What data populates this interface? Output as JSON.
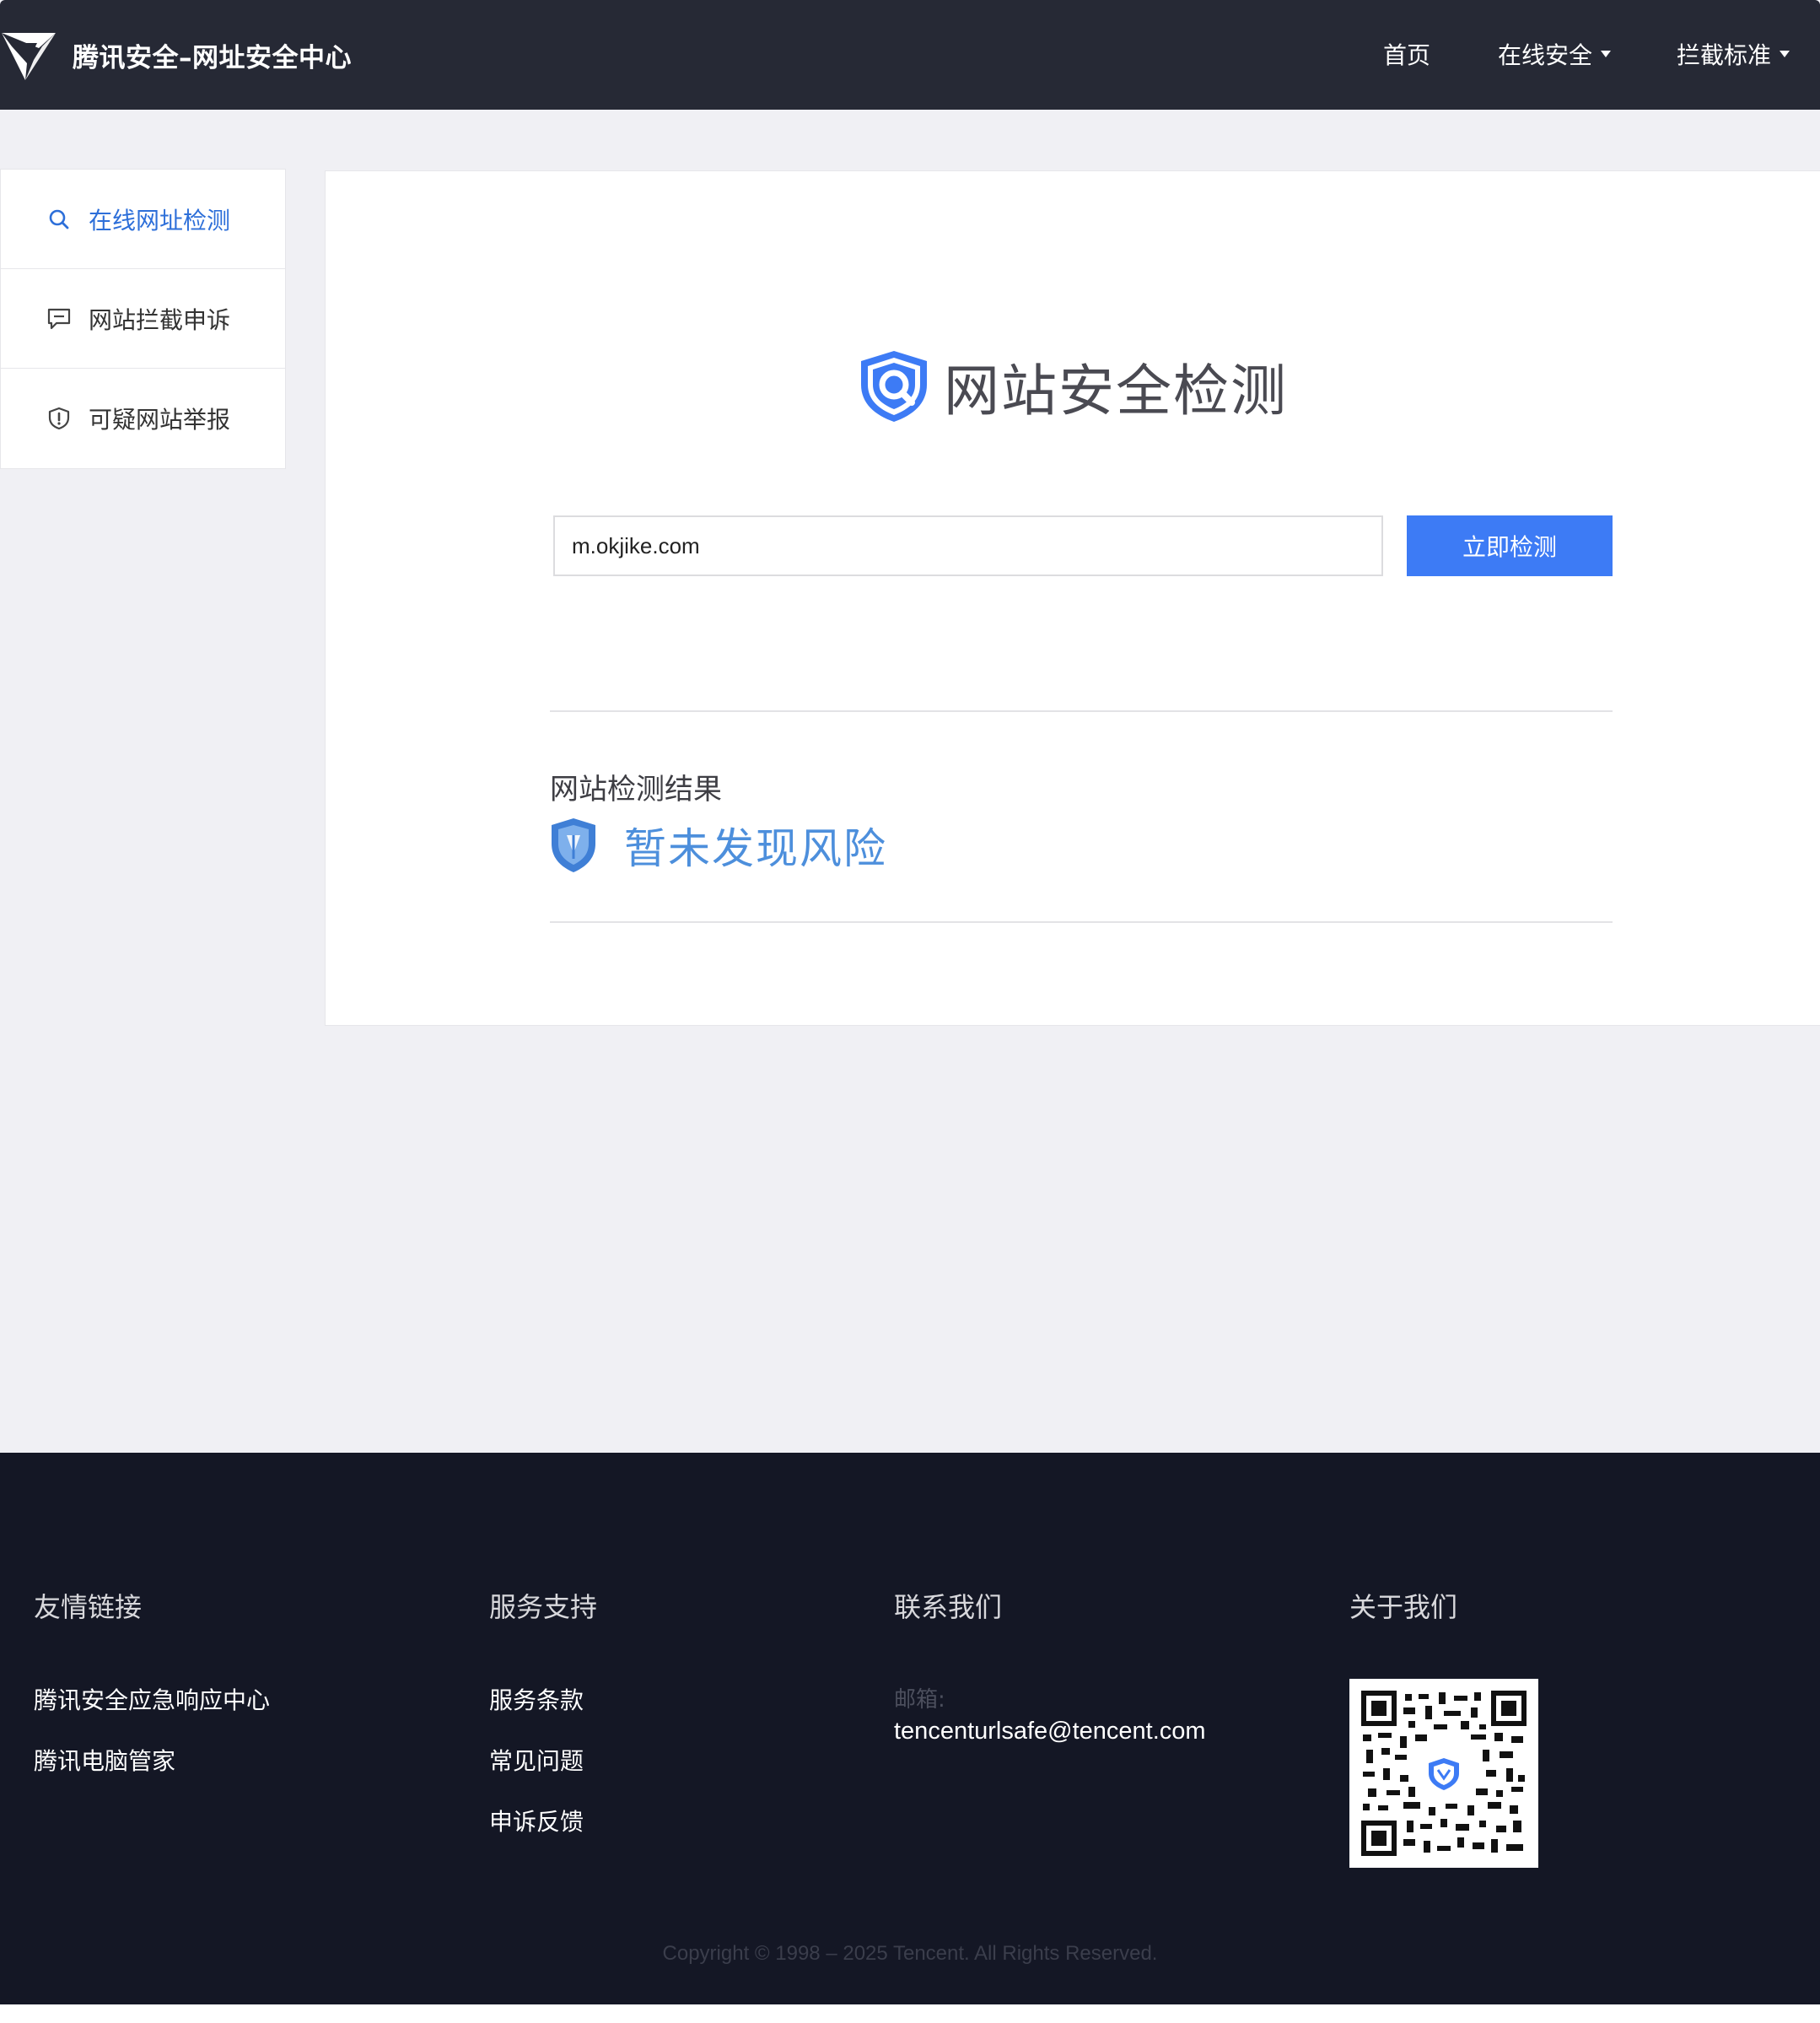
{
  "header": {
    "brand_title": "腾讯安全–网址安全中心",
    "nav": [
      {
        "label": "首页",
        "has_dropdown": false
      },
      {
        "label": "在线安全",
        "has_dropdown": true
      },
      {
        "label": "拦截标准",
        "has_dropdown": true
      }
    ]
  },
  "sidebar": {
    "items": [
      {
        "label": "在线网址检测",
        "icon": "search-icon",
        "active": true
      },
      {
        "label": "网站拦截申诉",
        "icon": "message-icon",
        "active": false
      },
      {
        "label": "可疑网站举报",
        "icon": "shield-alert-icon",
        "active": false
      }
    ]
  },
  "main": {
    "title": "网站安全检测",
    "search": {
      "value": "m.okjike.com",
      "placeholder": ""
    },
    "check_button": "立即检测",
    "result_title": "网站检测结果",
    "result_status": "暂未发现风险"
  },
  "footer": {
    "friend_links": {
      "heading": "友情链接",
      "links": [
        "腾讯安全应急响应中心",
        "腾讯电脑管家"
      ]
    },
    "support": {
      "heading": "服务支持",
      "links": [
        "服务条款",
        "常见问题",
        "申诉反馈"
      ]
    },
    "contact": {
      "heading": "联系我们",
      "email_label": "邮箱:",
      "email": "tencenturlsafe@tencent.com"
    },
    "about": {
      "heading": "关于我们"
    },
    "copyright": "Copyright © 1998 – 2025 Tencent. All Rights Reserved."
  },
  "colors": {
    "header_bg": "#262935",
    "accent": "#3d7bf5",
    "active_link": "#2d6fd9",
    "result_status": "#4d8fdc",
    "footer_bg": "#141725"
  }
}
